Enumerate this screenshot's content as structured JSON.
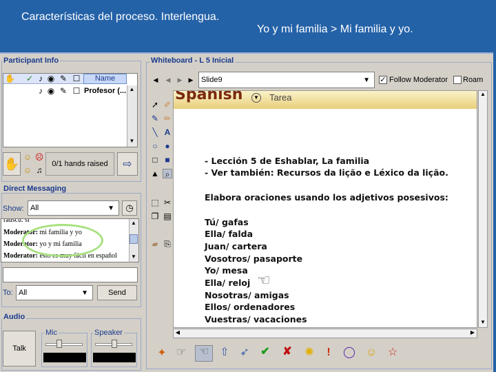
{
  "slide": {
    "title": "Características del proceso. Interlengua.",
    "breadcrumb": "Yo y mi familia > Mi familia y yo."
  },
  "participant_panel": {
    "title": "Participant Info",
    "column_name": "Name",
    "participants": [
      {
        "name": "Profesor (..."
      }
    ],
    "hands_raised": "0/1 hands raised"
  },
  "messaging_panel": {
    "title": "Direct Messaging",
    "show_label": "Show:",
    "show_value": "All",
    "messages": [
      {
        "sender": "",
        "text": "rauscu. si"
      },
      {
        "sender": "Moderator:",
        "text": "mi familia y yo"
      },
      {
        "sender": "Moderator:",
        "text": "yo y mi familia"
      },
      {
        "sender": "Moderator:",
        "text": "esto es muy fácil en español"
      }
    ],
    "to_label": "To:",
    "to_value": "All",
    "send_label": "Send"
  },
  "audio_panel": {
    "title": "Audio",
    "talk_label": "Talk",
    "mic_label": "Mic",
    "speaker_label": "Speaker"
  },
  "whiteboard": {
    "title": "Whiteboard - L 5 Inicial",
    "slide_select": "Slide9",
    "follow_moderator": "Follow Moderator",
    "roam": "Roam",
    "banner_logo": "Spanish",
    "banner_tab": "Tarea",
    "lines": [
      "- Lección 5 de Eshablar, La familia",
      "- Ver también: Recursos da lição e Léxico da lição.",
      "Elabora oraciones usando los adjetivos posesivos:",
      "Tú/ gafas",
      "Ella/ falda",
      "Juan/ cartera",
      "Vosotros/ pasaporte",
      "Yo/ mesa",
      "Ella/ reloj",
      "Nosotras/ amigas",
      "Ellos/ ordenadores",
      "Vuestras/ vacaciones"
    ]
  },
  "colors": {
    "background": "#2462a8",
    "panel": "#d4d0c8",
    "panel_title": "#1a3a8c",
    "banner": "#f0d888",
    "annotation_circle": "#a8e080"
  }
}
